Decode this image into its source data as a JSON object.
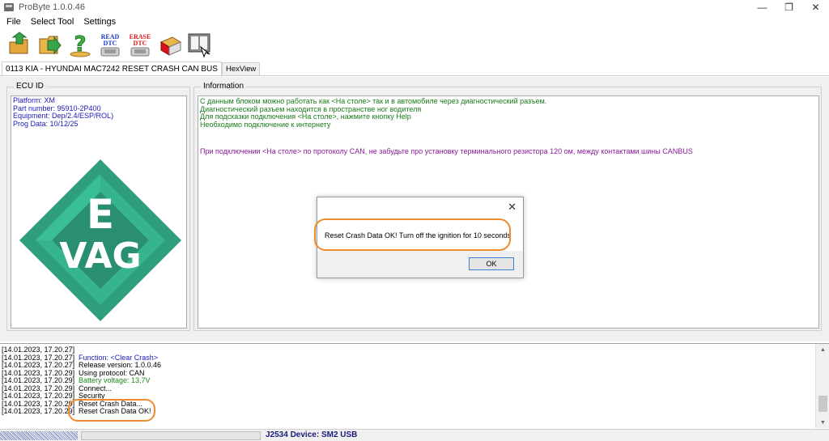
{
  "window": {
    "title": "ProByte   1.0.0.46",
    "minimize_symbol": "—",
    "maximize_symbol": "❐",
    "close_symbol": "✕"
  },
  "menu": [
    "File",
    "Select Tool",
    "Settings"
  ],
  "toolbar": {
    "buttons": [
      {
        "name": "open-folder",
        "label": ""
      },
      {
        "name": "save-folder",
        "label": ""
      },
      {
        "name": "help",
        "label": ""
      },
      {
        "name": "read-dtc",
        "label": "READ DTC"
      },
      {
        "name": "erase-dtc",
        "label": "ERASE DTC"
      },
      {
        "name": "tool-box",
        "label": ""
      },
      {
        "name": "manual",
        "label": ""
      }
    ]
  },
  "tabs": [
    {
      "label": "0113 KIA - HYUNDAI MAC7242 RESET CRASH CAN BUS",
      "active": true
    },
    {
      "label": "HexView",
      "active": false
    }
  ],
  "ecu": {
    "group_label": "ECU ID",
    "lines": [
      "Platform: XM",
      "Part number: 95910-2P400",
      "Equipment: Dep/2.4/ESP/ROL)",
      "Prog Data: 10/12/25"
    ],
    "logo_text_top": "E",
    "logo_text_bottom": "VAG"
  },
  "info": {
    "group_label": "Information",
    "lines": [
      "С данным блоком можно работать как <На столе> так и в автомобиле через диагностический разъем.",
      "Диагностический разъем находится в пространстве ног водителя",
      "Для подсказки подключения <На столе>, нажмите кнопку Help",
      "Необходимо подключение к интернету"
    ],
    "warning": "При подключении  <На столе> по протоколу CAN, не забудьте про установку терминального резистора 120 ом, между контактами шины CANBUS"
  },
  "dialog": {
    "message": "Reset Crash Data OK! Turn off the ignition for 10 seconds",
    "ok_label": "OK",
    "close_symbol": "✕"
  },
  "log": [
    {
      "ts": "[14.01.2023, 17.20.27]",
      "msg": "",
      "color": "black"
    },
    {
      "ts": "[14.01.2023, 17.20.27]",
      "msg": "Function: <Clear Crash>",
      "color": "blue"
    },
    {
      "ts": "[14.01.2023, 17.20.27]",
      "msg": "Release version: 1.0.0.46",
      "color": "black"
    },
    {
      "ts": "[14.01.2023, 17.20.29]",
      "msg": "Using protocol: CAN",
      "color": "black"
    },
    {
      "ts": "[14.01.2023, 17.20.29]",
      "msg": "Battery voltage: 13,7V",
      "color": "green"
    },
    {
      "ts": "[14.01.2023, 17.20.29]",
      "msg": "Connect...",
      "color": "black"
    },
    {
      "ts": "[14.01.2023, 17.20.29]",
      "msg": "Security",
      "color": "black"
    },
    {
      "ts": "[14.01.2023, 17.20.29]",
      "msg": "Reset Crash Data...",
      "color": "black"
    },
    {
      "ts": "[14.01.2023, 17.20.29]",
      "msg": "Reset Crash Data OK!",
      "color": "black"
    }
  ],
  "statusbar": {
    "device": "J2534 Device: SM2 USB"
  },
  "colors": {
    "highlight": "#ee8a2f",
    "logo_green": "#2e9e7e",
    "ecu_text": "#1a1ab8",
    "info_text": "#1a7a1a",
    "warning_text": "#8a1a9a"
  }
}
